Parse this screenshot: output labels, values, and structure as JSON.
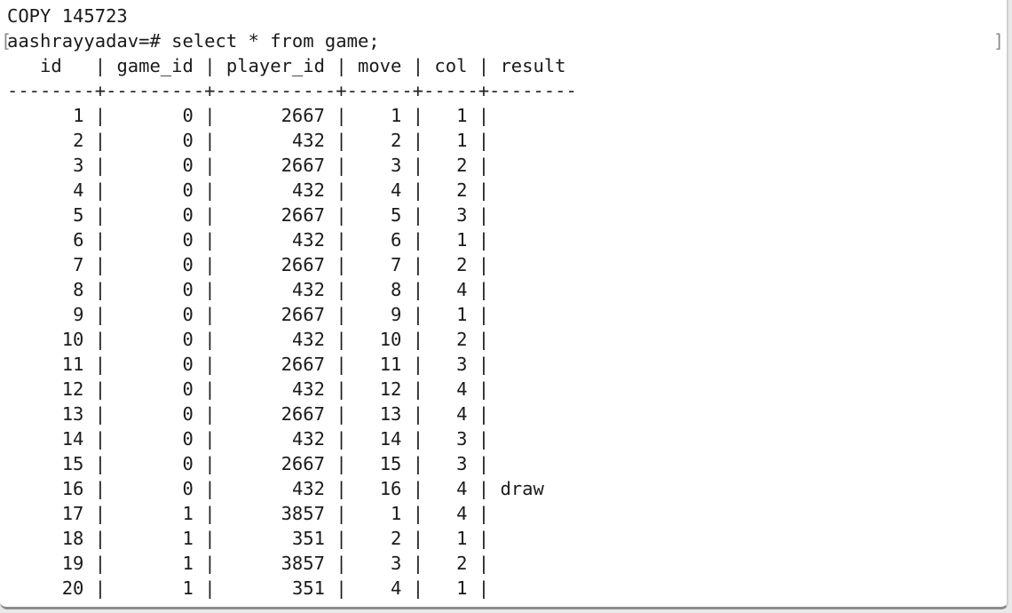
{
  "terminal": {
    "copy_line": "COPY 145723",
    "prompt": "aashrayyadav=#",
    "command": "select * from game;",
    "columns": [
      "id",
      "game_id",
      "player_id",
      "move",
      "col",
      "result"
    ],
    "rows": [
      {
        "id": "1",
        "game_id": "0",
        "player_id": "2667",
        "move": "1",
        "col": "1",
        "result": ""
      },
      {
        "id": "2",
        "game_id": "0",
        "player_id": "432",
        "move": "2",
        "col": "1",
        "result": ""
      },
      {
        "id": "3",
        "game_id": "0",
        "player_id": "2667",
        "move": "3",
        "col": "2",
        "result": ""
      },
      {
        "id": "4",
        "game_id": "0",
        "player_id": "432",
        "move": "4",
        "col": "2",
        "result": ""
      },
      {
        "id": "5",
        "game_id": "0",
        "player_id": "2667",
        "move": "5",
        "col": "3",
        "result": ""
      },
      {
        "id": "6",
        "game_id": "0",
        "player_id": "432",
        "move": "6",
        "col": "1",
        "result": ""
      },
      {
        "id": "7",
        "game_id": "0",
        "player_id": "2667",
        "move": "7",
        "col": "2",
        "result": ""
      },
      {
        "id": "8",
        "game_id": "0",
        "player_id": "432",
        "move": "8",
        "col": "4",
        "result": ""
      },
      {
        "id": "9",
        "game_id": "0",
        "player_id": "2667",
        "move": "9",
        "col": "1",
        "result": ""
      },
      {
        "id": "10",
        "game_id": "0",
        "player_id": "432",
        "move": "10",
        "col": "2",
        "result": ""
      },
      {
        "id": "11",
        "game_id": "0",
        "player_id": "2667",
        "move": "11",
        "col": "3",
        "result": ""
      },
      {
        "id": "12",
        "game_id": "0",
        "player_id": "432",
        "move": "12",
        "col": "4",
        "result": ""
      },
      {
        "id": "13",
        "game_id": "0",
        "player_id": "2667",
        "move": "13",
        "col": "4",
        "result": ""
      },
      {
        "id": "14",
        "game_id": "0",
        "player_id": "432",
        "move": "14",
        "col": "3",
        "result": ""
      },
      {
        "id": "15",
        "game_id": "0",
        "player_id": "2667",
        "move": "15",
        "col": "3",
        "result": ""
      },
      {
        "id": "16",
        "game_id": "0",
        "player_id": "432",
        "move": "16",
        "col": "4",
        "result": "draw"
      },
      {
        "id": "17",
        "game_id": "1",
        "player_id": "3857",
        "move": "1",
        "col": "4",
        "result": ""
      },
      {
        "id": "18",
        "game_id": "1",
        "player_id": "351",
        "move": "2",
        "col": "1",
        "result": ""
      },
      {
        "id": "19",
        "game_id": "1",
        "player_id": "3857",
        "move": "3",
        "col": "2",
        "result": ""
      },
      {
        "id": "20",
        "game_id": "1",
        "player_id": "351",
        "move": "4",
        "col": "1",
        "result": ""
      }
    ]
  }
}
